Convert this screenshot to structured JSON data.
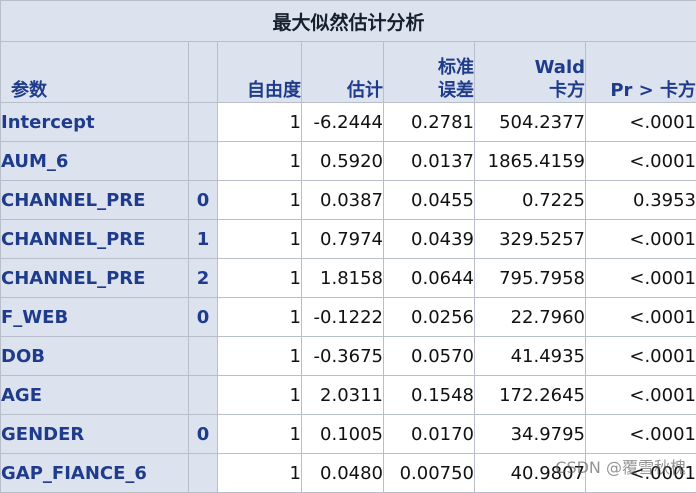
{
  "title": "最大似然估计分析",
  "headers": {
    "param": "参数",
    "df": "自由度",
    "estimate": "估计",
    "se_line1": "标准",
    "se_line2": "误差",
    "wald_line1": "Wald",
    "wald_line2": "卡方",
    "p": "Pr > 卡方"
  },
  "rows": [
    {
      "param": "Intercept",
      "level": "",
      "df": "1",
      "estimate": "-6.2444",
      "se": "0.2781",
      "wald": "504.2377",
      "p": "<.0001"
    },
    {
      "param": "AUM_6",
      "level": "",
      "df": "1",
      "estimate": "0.5920",
      "se": "0.0137",
      "wald": "1865.4159",
      "p": "<.0001"
    },
    {
      "param": "CHANNEL_PRE",
      "level": "0",
      "df": "1",
      "estimate": "0.0387",
      "se": "0.0455",
      "wald": "0.7225",
      "p": "0.3953"
    },
    {
      "param": "CHANNEL_PRE",
      "level": "1",
      "df": "1",
      "estimate": "0.7974",
      "se": "0.0439",
      "wald": "329.5257",
      "p": "<.0001"
    },
    {
      "param": "CHANNEL_PRE",
      "level": "2",
      "df": "1",
      "estimate": "1.8158",
      "se": "0.0644",
      "wald": "795.7958",
      "p": "<.0001"
    },
    {
      "param": "F_WEB",
      "level": "0",
      "df": "1",
      "estimate": "-0.1222",
      "se": "0.0256",
      "wald": "22.7960",
      "p": "<.0001"
    },
    {
      "param": "DOB",
      "level": "",
      "df": "1",
      "estimate": "-0.3675",
      "se": "0.0570",
      "wald": "41.4935",
      "p": "<.0001"
    },
    {
      "param": "AGE",
      "level": "",
      "df": "1",
      "estimate": "2.0311",
      "se": "0.1548",
      "wald": "172.2645",
      "p": "<.0001"
    },
    {
      "param": "GENDER",
      "level": "0",
      "df": "1",
      "estimate": "0.1005",
      "se": "0.0170",
      "wald": "34.9795",
      "p": "<.0001"
    },
    {
      "param": "GAP_FIANCE_6",
      "level": "",
      "df": "1",
      "estimate": "0.0480",
      "se": "0.00750",
      "wald": "40.9807",
      "p": "<.0001"
    }
  ],
  "watermark": "CSDN @覆雪秋槐",
  "colors": {
    "header_bg": "#dce3ef",
    "header_text": "#1f3c8c",
    "border": "#b9bfca"
  }
}
